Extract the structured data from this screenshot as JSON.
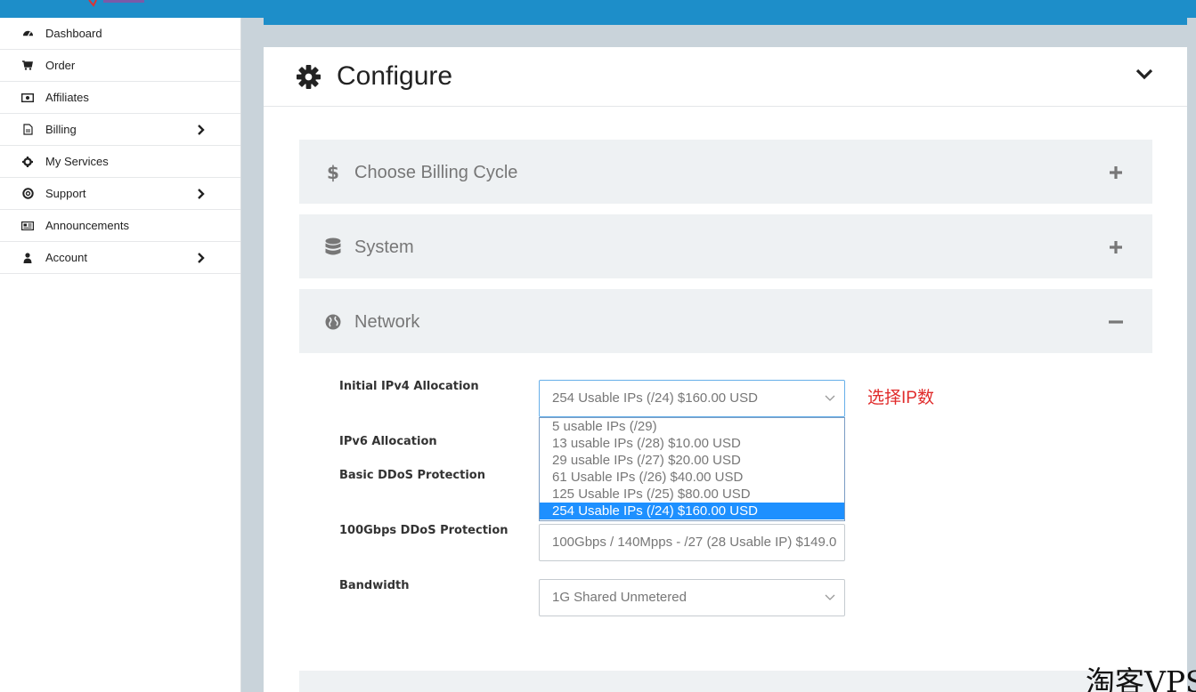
{
  "sidebar": {
    "items": [
      {
        "label": "Dashboard",
        "icon": "dashboard-icon",
        "has_submenu": false
      },
      {
        "label": "Order",
        "icon": "cart-icon",
        "has_submenu": false
      },
      {
        "label": "Affiliates",
        "icon": "money-icon",
        "has_submenu": false
      },
      {
        "label": "Billing",
        "icon": "invoice-icon",
        "has_submenu": true
      },
      {
        "label": "My Services",
        "icon": "cog-icon",
        "has_submenu": false
      },
      {
        "label": "Support",
        "icon": "lifebuoy-icon",
        "has_submenu": true
      },
      {
        "label": "Announcements",
        "icon": "newspaper-icon",
        "has_submenu": false
      },
      {
        "label": "Account",
        "icon": "user-icon",
        "has_submenu": true
      }
    ]
  },
  "panel": {
    "title": "Configure",
    "sections": [
      {
        "label": "Choose Billing Cycle",
        "icon": "dollar-icon",
        "state": "collapsed"
      },
      {
        "label": "System",
        "icon": "database-icon",
        "state": "collapsed"
      },
      {
        "label": "Network",
        "icon": "globe-icon",
        "state": "expanded"
      }
    ]
  },
  "network": {
    "ipv4": {
      "label": "Initial IPv4 Allocation",
      "value": "254 Usable IPs (/24) $160.00 USD",
      "options": [
        "5 usable IPs (/29)",
        "13 usable IPs (/28) $10.00 USD",
        "29 usable IPs (/27) $20.00 USD",
        "61 Usable IPs (/26) $40.00 USD",
        "125 Usable IPs (/25) $80.00 USD",
        "254 Usable IPs (/24) $160.00 USD"
      ],
      "selected_index": 5
    },
    "ipv6": {
      "label": "IPv6 Allocation"
    },
    "basic_ddos": {
      "label": "Basic DDoS Protection"
    },
    "ddos_100g": {
      "label": "100Gbps DDoS Protection",
      "value": "100Gbps / 140Mpps - /27 (28 Usable IP) $149.0"
    },
    "bandwidth": {
      "label": "Bandwidth",
      "value": "1G Shared Unmetered"
    }
  },
  "annotation": "选择IP数",
  "watermark": "淘客VPS",
  "colors": {
    "accent": "#1d8ec9",
    "selected": "#1e90ff",
    "annotation": "#e02b2b"
  }
}
